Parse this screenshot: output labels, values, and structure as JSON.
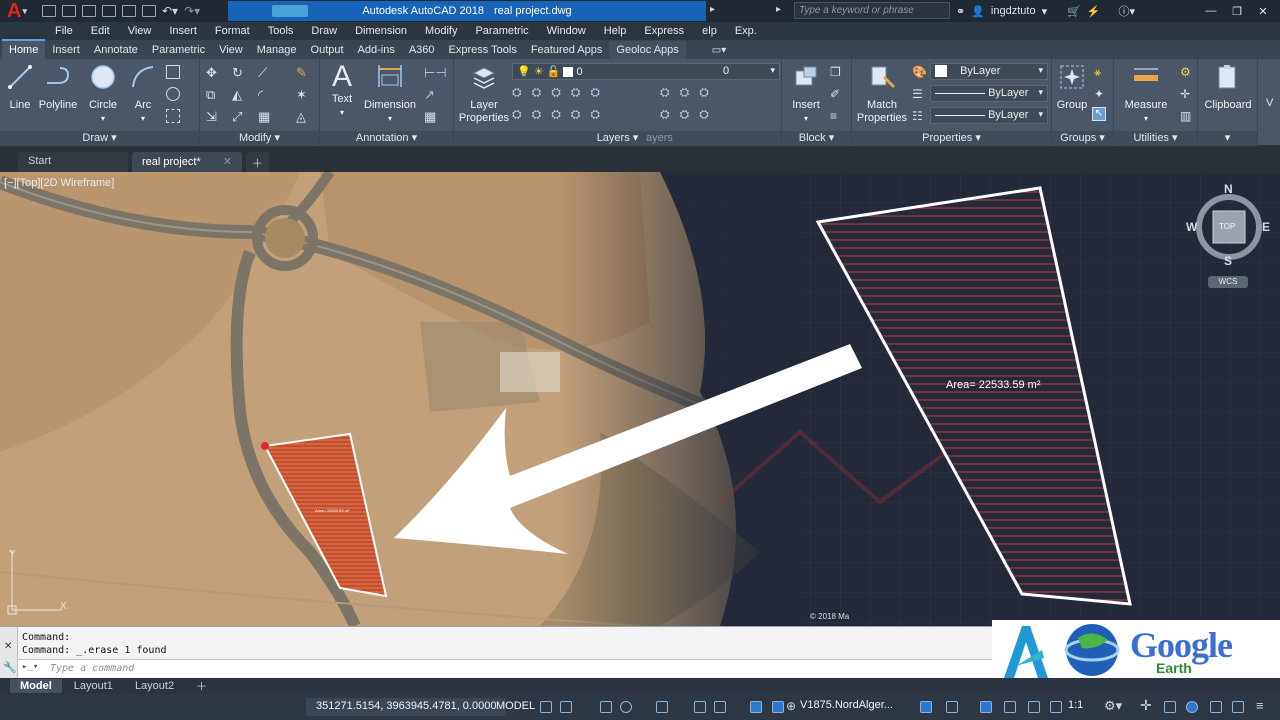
{
  "title_bar": {
    "app_title": "Autodesk AutoCAD 2018",
    "file_name": "real project.dwg",
    "search_placeholder": "Type a keyword or phrase",
    "username": "ingdztuto"
  },
  "menu": [
    "File",
    "Edit",
    "View",
    "Insert",
    "Format",
    "Tools",
    "Draw",
    "Dimension",
    "Modify",
    "Parametric",
    "Window",
    "Help",
    "Express",
    "elp",
    "Exp."
  ],
  "ribbon_tabs": [
    "Home",
    "Insert",
    "Annotate",
    "Parametric",
    "View",
    "Manage",
    "Output",
    "Add-ins",
    "A360",
    "Express Tools",
    "Featured Apps",
    "Geoloc Apps"
  ],
  "ribbon": {
    "draw": {
      "title": "Draw",
      "tools": [
        "Line",
        "Polyline",
        "Circle",
        "Arc"
      ]
    },
    "modify": {
      "title": "Modify"
    },
    "annotation": {
      "title": "Annotation",
      "tools": [
        "Text",
        "Dimension"
      ]
    },
    "layers": {
      "title": "Layers",
      "tool_line1": "Layer",
      "tool_line2": "Properties",
      "layer_value": "0",
      "layer_value2": "0",
      "ghost": "ayers"
    },
    "block": {
      "title": "Block",
      "tool": "Insert"
    },
    "properties": {
      "title": "Properties",
      "tool_line1": "Match",
      "tool_line2": "Properties",
      "bylayer1": "ByLayer",
      "bylayer2": "ByLayer",
      "bylayer3": "ByLayer"
    },
    "groups": {
      "title": "Groups",
      "tool": "Group"
    },
    "utilities": {
      "title": "Utilities",
      "tool": "Measure"
    },
    "clipboard": {
      "tool": "Clipboard"
    }
  },
  "doc_tabs": [
    "Start",
    "real project*"
  ],
  "viewport": {
    "label": "[−][Top][2D Wireframe]",
    "area_label_large": "Area= 22533.59 m²",
    "area_label_small": "Area= 22533.59 m²",
    "copyright": "© 2018 Ma",
    "compass": {
      "n": "N",
      "s": "S",
      "e": "E",
      "w": "W",
      "top": "TOP",
      "wcs": "WCS"
    }
  },
  "command": {
    "history": [
      "Command:",
      "Command:  _.erase 1 found"
    ],
    "placeholder": "Type a command"
  },
  "logos": {
    "google": "Google",
    "earth": "Earth"
  },
  "layout_tabs": [
    "Model",
    "Layout1",
    "Layout2"
  ],
  "status": {
    "coords": "351271.5154, 3963945.4781, 0.0000",
    "model": "MODEL",
    "v1875": "V1875.NordAlger...",
    "scale": "1:1"
  }
}
